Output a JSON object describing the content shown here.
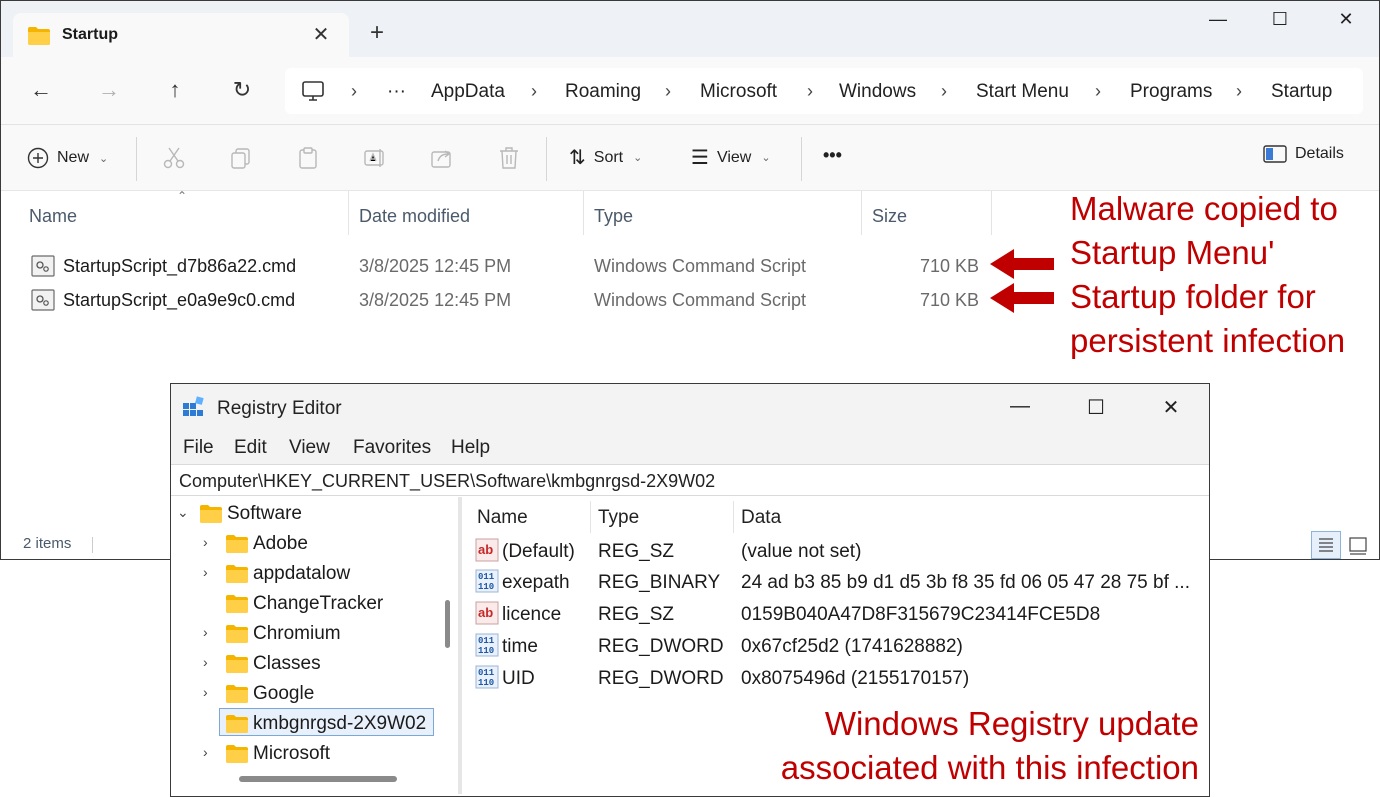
{
  "explorer": {
    "tab_title": "Startup",
    "window_controls": {
      "minimize": "—",
      "maximize": "☐",
      "close": "✕"
    },
    "breadcrumb": [
      "AppData",
      "Roaming",
      "Microsoft",
      "Windows",
      "Start Menu",
      "Programs",
      "Startup"
    ],
    "breadcrumb_more": "···",
    "toolbar": {
      "new_label": "New",
      "sort_label": "Sort",
      "view_label": "View",
      "more_label": "•••",
      "details_label": "Details"
    },
    "columns": {
      "name": "Name",
      "date": "Date modified",
      "type": "Type",
      "size": "Size"
    },
    "files": [
      {
        "name": "StartupScript_d7b86a22.cmd",
        "date": "3/8/2025 12:45 PM",
        "type": "Windows Command Script",
        "size": "710 KB"
      },
      {
        "name": "StartupScript_e0a9e9c0.cmd",
        "date": "3/8/2025 12:45 PM",
        "type": "Windows Command Script",
        "size": "710 KB"
      }
    ],
    "status": "2 items"
  },
  "annotations": {
    "startup": [
      "Malware copied to",
      "Startup Menu'",
      "Startup folder for",
      "persistent infection"
    ],
    "registry": [
      "Windows Registry update",
      "associated with this infection"
    ],
    "color": "#c00000"
  },
  "regedit": {
    "title": "Registry Editor",
    "menu": [
      "File",
      "Edit",
      "View",
      "Favorites",
      "Help"
    ],
    "path": "Computer\\HKEY_CURRENT_USER\\Software\\kmbgnrgsd-2X9W02",
    "tree": [
      {
        "label": "Software",
        "expanded": true
      },
      {
        "label": "Adobe"
      },
      {
        "label": "appdatalow"
      },
      {
        "label": "ChangeTracker"
      },
      {
        "label": "Chromium"
      },
      {
        "label": "Classes"
      },
      {
        "label": "Google"
      },
      {
        "label": "kmbgnrgsd-2X9W02",
        "selected": true
      },
      {
        "label": "Microsoft"
      }
    ],
    "columns": {
      "name": "Name",
      "type": "Type",
      "data": "Data"
    },
    "values": [
      {
        "icon": "string-value-icon",
        "name": "(Default)",
        "type": "REG_SZ",
        "data": "(value not set)"
      },
      {
        "icon": "binary-value-icon",
        "name": "exepath",
        "type": "REG_BINARY",
        "data": "24 ad b3 85 b9 d1 d5 3b f8 35 fd 06 05 47 28 75 bf ..."
      },
      {
        "icon": "string-value-icon",
        "name": "licence",
        "type": "REG_SZ",
        "data": "0159B040A47D8F315679C23414FCE5D8"
      },
      {
        "icon": "binary-value-icon",
        "name": "time",
        "type": "REG_DWORD",
        "data": "0x67cf25d2 (1741628882)"
      },
      {
        "icon": "binary-value-icon",
        "name": "UID",
        "type": "REG_DWORD",
        "data": "0x8075496d (2155170157)"
      }
    ]
  }
}
